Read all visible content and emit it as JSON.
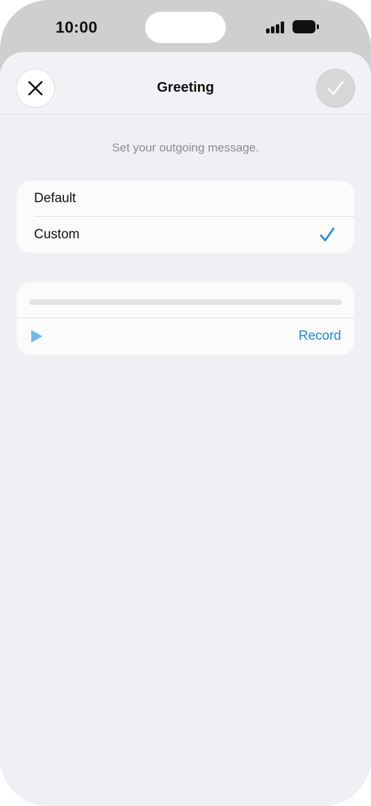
{
  "status_bar": {
    "time": "10:00"
  },
  "nav": {
    "title": "Greeting",
    "close_icon": "close-icon",
    "done_icon": "checkmark-icon"
  },
  "subtitle": "Set your outgoing message.",
  "options": [
    {
      "label": "Default",
      "selected": false
    },
    {
      "label": "Custom",
      "selected": true
    }
  ],
  "recording": {
    "progress": 0,
    "play_icon": "play-icon",
    "record_label": "Record"
  },
  "colors": {
    "accent": "#1a8ad6",
    "background": "#efeff4",
    "card": "#fbfbfc"
  }
}
